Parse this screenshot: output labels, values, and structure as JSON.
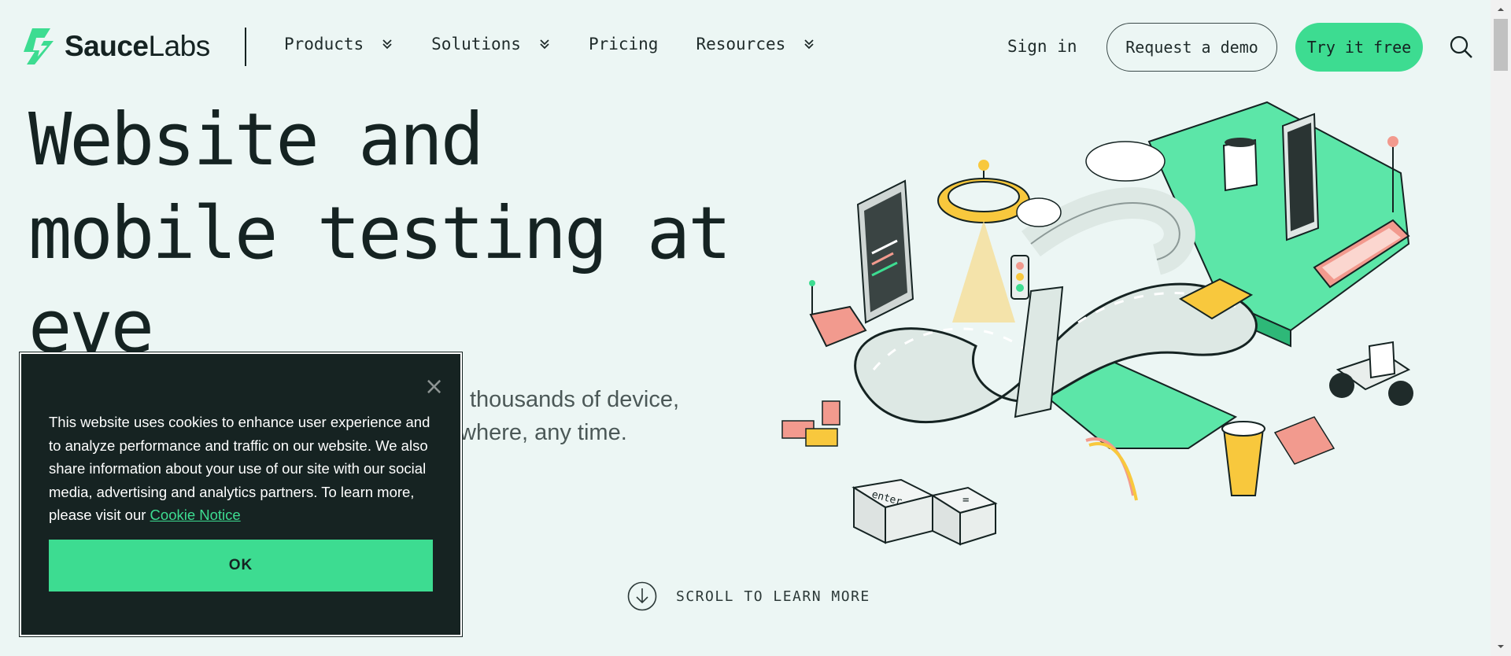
{
  "brand": {
    "name_bold": "Sauce",
    "name_regular": "Labs",
    "accent": "#3ddc91",
    "dark": "#152322"
  },
  "nav": {
    "items": [
      {
        "label": "Products",
        "has_dropdown": true
      },
      {
        "label": "Solutions",
        "has_dropdown": true
      },
      {
        "label": "Pricing",
        "has_dropdown": false
      },
      {
        "label": "Resources",
        "has_dropdown": true
      }
    ],
    "sign_in": "Sign in",
    "request_demo": "Request a demo",
    "try_free": "Try it free"
  },
  "hero": {
    "title_lines": [
      "Website and",
      "mobile testing at",
      "eve_"
    ],
    "subtitle_visible": [
      "thousands of device,",
      "where, any time."
    ]
  },
  "scroll_cta": "SCROLL TO LEARN MORE",
  "cookie": {
    "text": "This website uses cookies to enhance user experience and to analyze performance and traffic on our website. We also share information about your use of our site with our social media, advertising and analytics partners. To learn more, please visit our",
    "link": "Cookie Notice",
    "ok": "OK",
    "close": "×"
  },
  "illustration": {
    "keycaps": [
      "enter",
      "="
    ]
  }
}
